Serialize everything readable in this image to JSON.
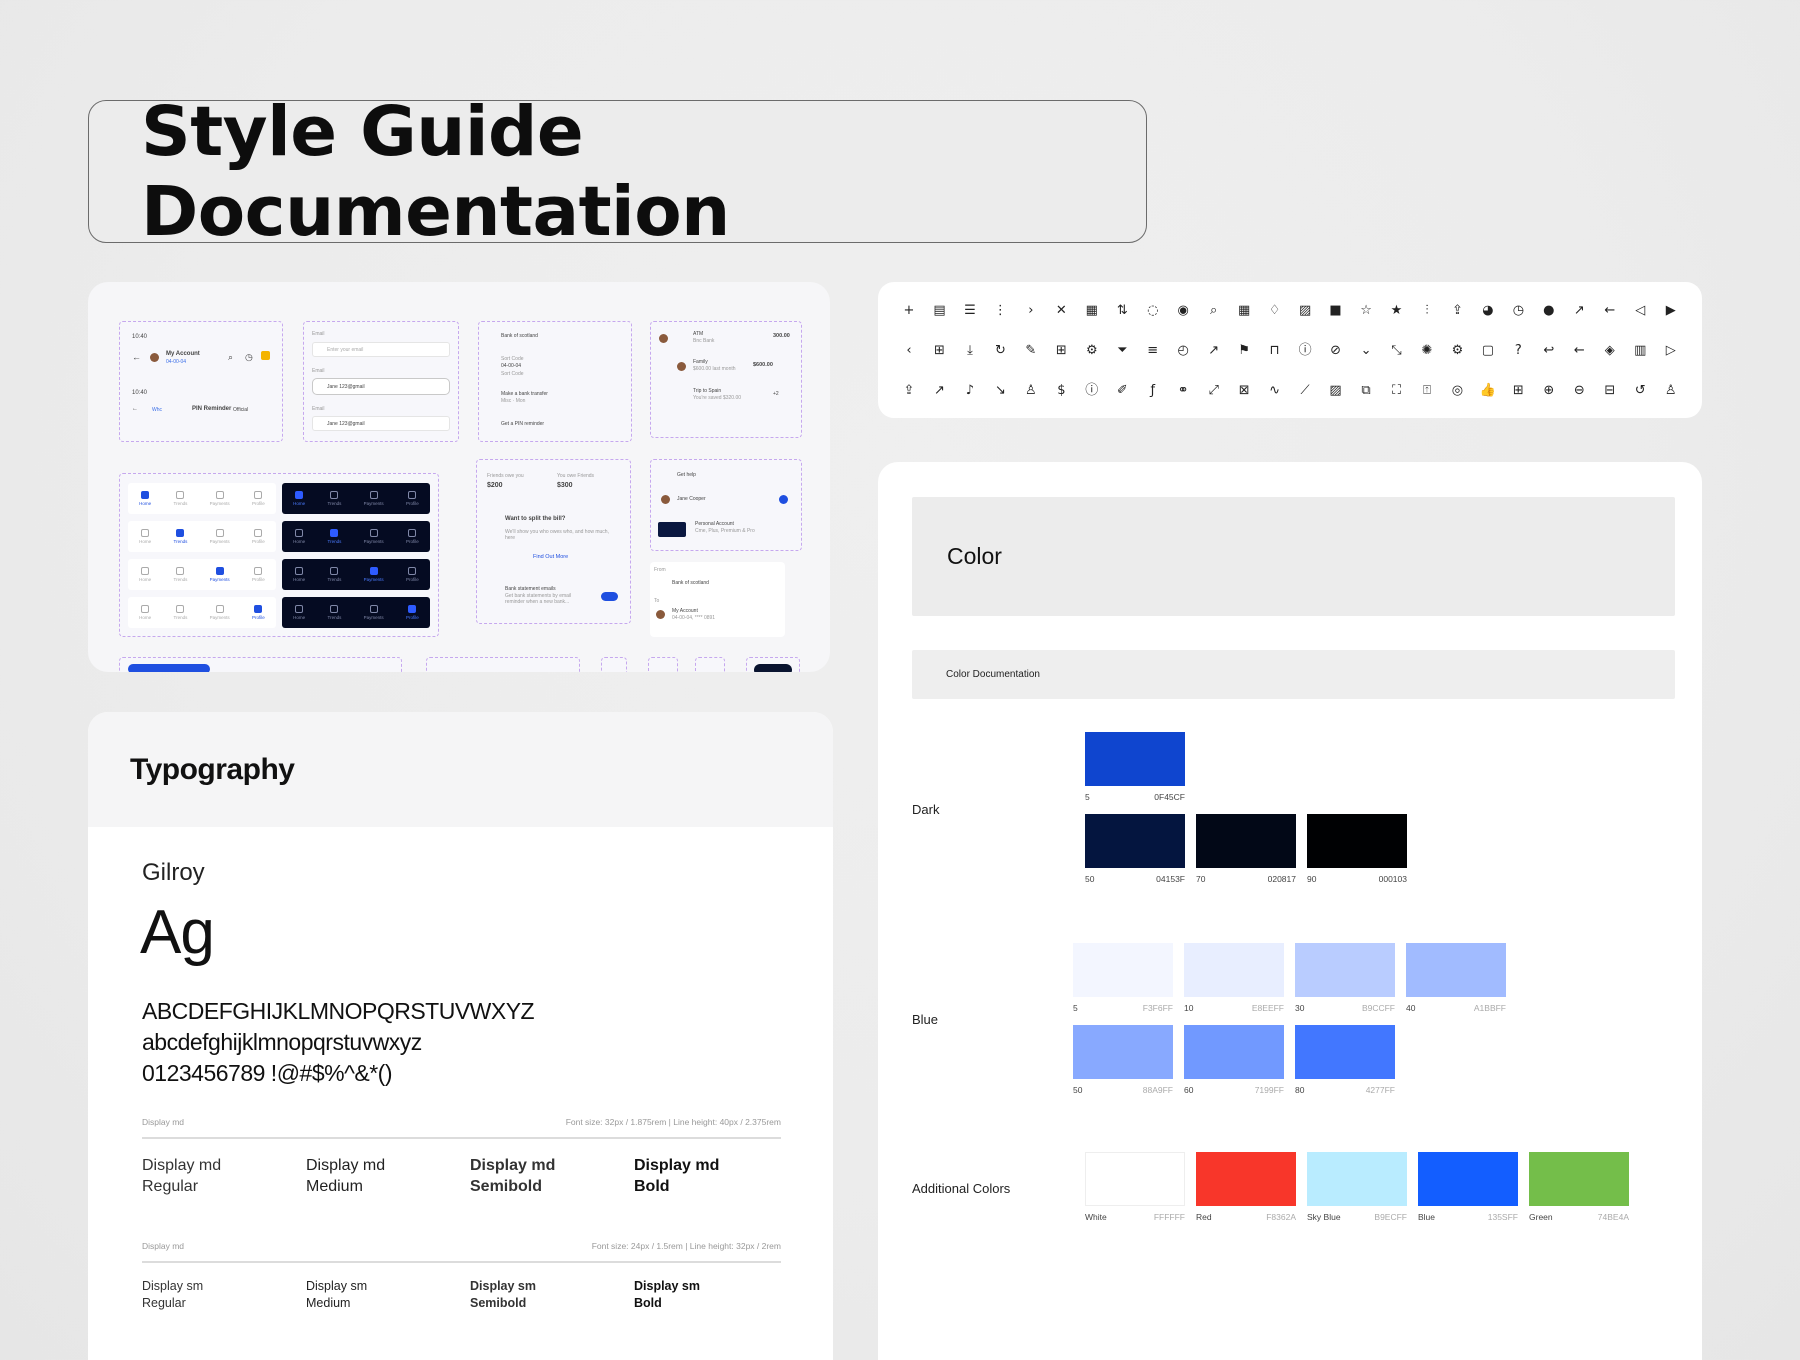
{
  "title": "Style Guide Documentation",
  "components": {
    "header_card": {
      "time": "10:40",
      "account": "My Account",
      "sort": "04-00-04",
      "back_label": "Whc",
      "reminder": "PIN Reminder",
      "official": "Official"
    },
    "email_card": {
      "label1": "Email",
      "placeholder": "Enter your email",
      "label2": "Email",
      "value2": "Jane 123@gmail",
      "label3": "Email",
      "value3": "Jane 123@gmail"
    },
    "bank_card": {
      "bank": "Bank of scotland",
      "sort_label": "Sort Code",
      "sort_value": "04-00-04",
      "sort_sub": "Sort Code",
      "transfer": "Make a bank transfer",
      "transfer_sub": "Misc · Mon",
      "pin": "Get a PIN reminder"
    },
    "tx_card": {
      "atm": "ATM",
      "atm_sub": "Bnc Bank",
      "atm_amount": "300.00",
      "family": "Family",
      "family_sub": "$600.00 last month",
      "family_amount": "$600.00",
      "trip": "Trip to Spain",
      "trip_sub": "You're saved $320.00",
      "trip_count": "+2"
    },
    "nav_labels": [
      "Home",
      "Trends",
      "Payments",
      "Profile"
    ],
    "split_card": {
      "owe_you_label": "Friends owe you",
      "owe_you": "$200",
      "you_owe_label": "You owe Friends",
      "you_owe": "$300",
      "question": "Want to split the bill?",
      "desc": "We'll show you who owes who, and how much, here",
      "cta": "Find Out More",
      "statement": "Bank statement emails",
      "statement_sub": "Get bank statements by email reminder when a new bank..."
    },
    "select_card": {
      "help": "Get help",
      "person": "Jane Cooper",
      "account": "Personal Account",
      "account_sub": "Cme, Plus, Premium & Pro"
    },
    "transfer_card": {
      "from": "From",
      "from_bank": "Bank of scotland",
      "to": "To",
      "to_account": "My Account",
      "to_sub": "04-00-04, **** 0891"
    }
  },
  "icons": {
    "row1": [
      "plus-icon",
      "document-icon",
      "list-icon",
      "more-vertical-icon",
      "chevron-right-icon",
      "close-icon",
      "newspaper-icon",
      "sort-icon",
      "chat-icon",
      "lightbulb-icon",
      "search-icon",
      "calendar-icon",
      "diamond-icon",
      "chart-icon",
      "chart-filled-icon",
      "star-icon",
      "star-filled-icon",
      "sliders-icon",
      "share-icon",
      "compass-filled-icon",
      "alarm-icon",
      "check-circle-icon",
      "external-icon",
      "arrow-left-icon",
      "volume-icon",
      "play-icon"
    ],
    "row2": [
      "chevron-left-icon",
      "grid-icon",
      "download-icon",
      "refresh-icon",
      "brush-icon",
      "grid-filled-icon",
      "settings-icon",
      "filter-icon",
      "menu-icon",
      "clock-icon",
      "arrow-up-right-icon",
      "flag-icon",
      "lock-icon",
      "info-icon",
      "compass-icon",
      "chevron-down-icon",
      "minimize-icon",
      "bulb-icon",
      "gear-icon",
      "message-icon",
      "help-icon",
      "undo-icon",
      "arrow-left-2-icon",
      "globe-icon",
      "bar-chart-icon",
      "play-outline-icon"
    ],
    "row3": [
      "upload-icon",
      "trending-up-icon",
      "bell-icon",
      "trending-down-icon",
      "user-icon",
      "dollar-icon",
      "info-2-icon",
      "pen-icon",
      "function-icon",
      "link-icon",
      "expand-icon",
      "tax-icon",
      "wave-icon",
      "line-chart-icon",
      "stats-icon",
      "copy-icon",
      "fullscreen-icon",
      "save-icon",
      "coins-icon",
      "thumbs-up-icon",
      "apps-icon",
      "add-circle-icon",
      "remove-circle-icon",
      "layout-icon",
      "refresh-2-icon",
      "user-remove-icon"
    ],
    "glyphs1": [
      "+",
      "▤",
      "☰",
      "⋮",
      "›",
      "✕",
      "▦",
      "⇅",
      "◌",
      "◉",
      "⌕",
      "▦",
      "♢",
      "▨",
      "■",
      "☆",
      "★",
      "⫶",
      "⇪",
      "◕",
      "◷",
      "●",
      "↗",
      "←",
      "◁",
      "▶"
    ],
    "glyphs2": [
      "‹",
      "⊞",
      "⤓",
      "↻",
      "✎",
      "⊞",
      "⚙",
      "⏷",
      "≡",
      "◴",
      "↗",
      "⚑",
      "⊓",
      "ⓘ",
      "⊘",
      "⌄",
      "⤡",
      "✺",
      "⚙",
      "▢",
      "?",
      "↩",
      "←",
      "◈",
      "▥",
      "▷"
    ],
    "glyphs3": [
      "⇪",
      "↗",
      "♪",
      "↘",
      "♙",
      "$",
      "ⓘ",
      "✐",
      "ƒ",
      "⚭",
      "⤢",
      "⊠",
      "∿",
      "⟋",
      "▨",
      "⧉",
      "⛶",
      "⍐",
      "◎",
      "👍",
      "⊞",
      "⊕",
      "⊖",
      "⊟",
      "↺",
      "♙"
    ]
  },
  "typography": {
    "heading": "Typography",
    "font_name": "Gilroy",
    "specimen": "Ag",
    "upper": "ABCDEFGHIJKLMNOPQRSTUVWXYZ",
    "lower": "abcdefghijklmnopqrstuvwxyz",
    "digits": "0123456789 !@#$%^&*()",
    "md": {
      "label": "Display md",
      "spec": "Font size: 32px / 1.875rem | Line height: 40px / 2.375rem",
      "weights": [
        {
          "l1": "Display md",
          "l2": "Regular"
        },
        {
          "l1": "Display md",
          "l2": "Medium"
        },
        {
          "l1": "Display md",
          "l2": "Semibold"
        },
        {
          "l1": "Display md",
          "l2": "Bold"
        }
      ]
    },
    "sm": {
      "label": "Display md",
      "spec": "Font size: 24px / 1.5rem | Line height: 32px / 2rem",
      "weights": [
        {
          "l1": "Display sm",
          "l2": "Regular"
        },
        {
          "l1": "Display sm",
          "l2": "Medium"
        },
        {
          "l1": "Display sm",
          "l2": "Semibold"
        },
        {
          "l1": "Display sm",
          "l2": "Bold"
        }
      ]
    }
  },
  "color": {
    "heading": "Color",
    "sub": "Color Documentation",
    "groups": {
      "dark": {
        "label": "Dark",
        "swatches": [
          {
            "name": "5",
            "hex": "0F45CF",
            "color": "#0F45CF"
          },
          {
            "name": "50",
            "hex": "04153F",
            "color": "#04153F"
          },
          {
            "name": "70",
            "hex": "020817",
            "color": "#020817"
          },
          {
            "name": "90",
            "hex": "000103",
            "color": "#000103"
          }
        ]
      },
      "blue": {
        "label": "Blue",
        "swatches": [
          {
            "name": "5",
            "hex": "F3F6FF",
            "color": "#F3F6FF"
          },
          {
            "name": "10",
            "hex": "E8EEFF",
            "color": "#E8EEFF"
          },
          {
            "name": "30",
            "hex": "B9CCFF",
            "color": "#B9CCFF"
          },
          {
            "name": "40",
            "hex": "A1BBFF",
            "color": "#A1BBFF"
          },
          {
            "name": "50",
            "hex": "88A9FF",
            "color": "#88A9FF"
          },
          {
            "name": "60",
            "hex": "7199FF",
            "color": "#7199FF"
          },
          {
            "name": "80",
            "hex": "4277FF",
            "color": "#4277FF"
          }
        ]
      },
      "additional": {
        "label": "Additional Colors",
        "swatches": [
          {
            "name": "White",
            "hex": "FFFFFF",
            "color": "#FFFFFF"
          },
          {
            "name": "Red",
            "hex": "F8362A",
            "color": "#F8362A"
          },
          {
            "name": "Sky Blue",
            "hex": "B9ECFF",
            "color": "#B9ECFF"
          },
          {
            "name": "Blue",
            "hex": "135SFF",
            "color": "#135EFF"
          },
          {
            "name": "Green",
            "hex": "74BE4A",
            "color": "#74BE4A"
          }
        ]
      }
    }
  }
}
